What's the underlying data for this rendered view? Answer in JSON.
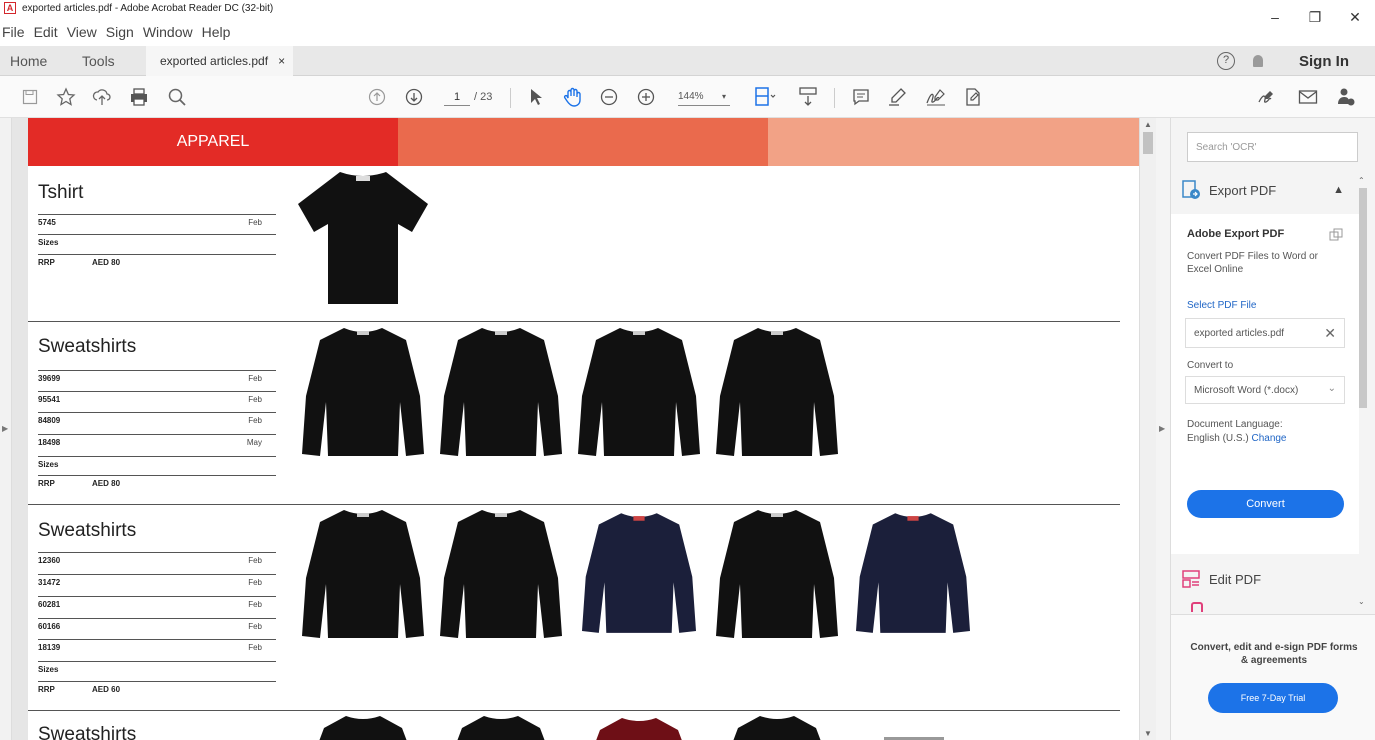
{
  "window": {
    "title": "exported articles.pdf - Adobe Acrobat Reader DC (32-bit)",
    "minimize_icon": "–",
    "restore_icon": "❐",
    "close_icon": "✕"
  },
  "menu": [
    "File",
    "Edit",
    "View",
    "Sign",
    "Window",
    "Help"
  ],
  "tabs": {
    "home": "Home",
    "tools": "Tools",
    "active_doc": "exported articles.pdf",
    "close": "×",
    "help": "?",
    "sign_in": "Sign In"
  },
  "toolbar": {
    "page_current": "1",
    "page_total": "/ 23",
    "zoom": "144%"
  },
  "document": {
    "header": "APPAREL",
    "colors": {
      "red": "#e32b26",
      "mid": "#ea6a4d",
      "light": "#f2a286"
    },
    "sections": [
      {
        "title": "Tshirt",
        "rows": [
          {
            "code": "5745",
            "month": "Feb"
          }
        ],
        "sizes_label": "Sizes",
        "rrp_label": "RRP",
        "rrp_value": "AED 80",
        "items": [
          "black-tshirt"
        ]
      },
      {
        "title": "Sweatshirts",
        "rows": [
          {
            "code": "39699",
            "month": "Feb"
          },
          {
            "code": "95541",
            "month": "Feb"
          },
          {
            "code": "84809",
            "month": "Feb"
          },
          {
            "code": "18498",
            "month": "May"
          }
        ],
        "sizes_label": "Sizes",
        "rrp_label": "RRP",
        "rrp_value": "AED 80",
        "items": [
          "black",
          "black",
          "black",
          "black"
        ]
      },
      {
        "title": "Sweatshirts",
        "rows": [
          {
            "code": "12360",
            "month": "Feb"
          },
          {
            "code": "31472",
            "month": "Feb"
          },
          {
            "code": "60281",
            "month": "Feb"
          },
          {
            "code": "60166",
            "month": "Feb"
          },
          {
            "code": "18139",
            "month": "Feb"
          }
        ],
        "sizes_label": "Sizes",
        "rrp_label": "RRP",
        "rrp_value": "AED 60",
        "items": [
          "black",
          "black",
          "navy",
          "black",
          "navy"
        ]
      },
      {
        "title": "Sweatshirts"
      }
    ]
  },
  "right_panel": {
    "search_placeholder": "Search 'OCR'",
    "export_pdf": "Export PDF",
    "adobe_export_title": "Adobe Export PDF",
    "adobe_export_desc": "Convert PDF Files to Word or Excel Online",
    "select_file": "Select PDF File",
    "file_name": "exported articles.pdf",
    "convert_to_label": "Convert to",
    "convert_to_value": "Microsoft Word (*.docx)",
    "doc_language_label": "Document Language:",
    "doc_language_value": "English (U.S.)",
    "change_link": "Change",
    "convert_button": "Convert",
    "edit_pdf": "Edit PDF",
    "promo_text": "Convert, edit and e-sign PDF forms & agreements",
    "promo_button": "Free 7-Day Trial"
  }
}
